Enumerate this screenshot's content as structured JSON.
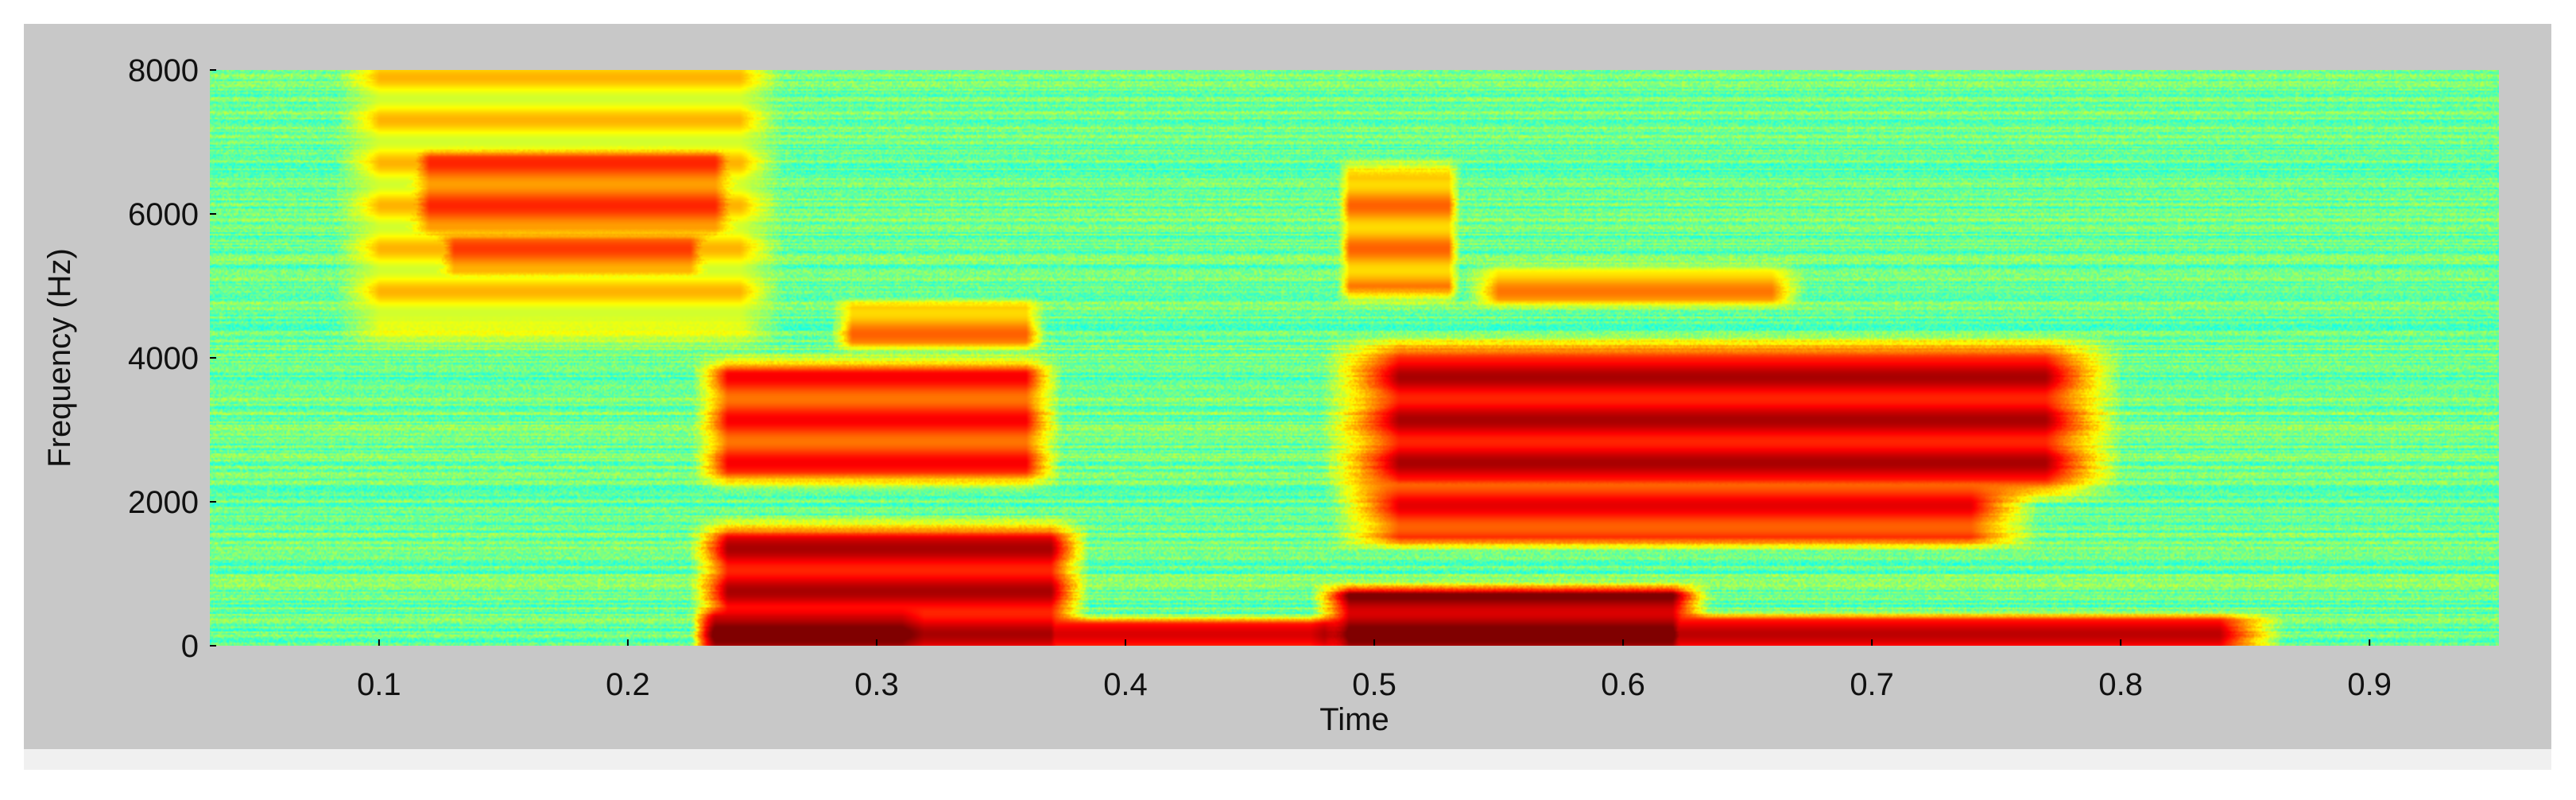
{
  "chart_data": {
    "type": "heatmap",
    "xlabel": "Time",
    "ylabel": "Frequency (Hz)",
    "xlim": [
      0.032,
      0.952
    ],
    "ylim": [
      0,
      8000
    ],
    "x_ticks": [
      0.1,
      0.2,
      0.3,
      0.4,
      0.5,
      0.6,
      0.7,
      0.8,
      0.9
    ],
    "x_tick_labels": [
      "0.1",
      "0.2",
      "0.3",
      "0.4",
      "0.5",
      "0.6",
      "0.7",
      "0.8",
      "0.9"
    ],
    "y_ticks": [
      0,
      2000,
      4000,
      6000,
      8000
    ],
    "y_tick_labels": [
      "0",
      "2000",
      "4000",
      "6000",
      "8000"
    ],
    "colormap": "jet",
    "background_level": 0.48,
    "energy_regions": [
      {
        "t_start": 0.12,
        "t_end": 0.235,
        "f_low": 5800,
        "f_high": 6800,
        "intensity": 0.78
      },
      {
        "t_start": 0.13,
        "t_end": 0.225,
        "f_low": 5200,
        "f_high": 5650,
        "intensity": 0.76
      },
      {
        "t_start": 0.1,
        "t_end": 0.245,
        "f_low": 4600,
        "f_high": 8000,
        "intensity": 0.64
      },
      {
        "t_start": 0.24,
        "t_end": 0.37,
        "f_low": 0,
        "f_high": 1500,
        "intensity": 0.9
      },
      {
        "t_start": 0.235,
        "t_end": 0.31,
        "f_low": 0,
        "f_high": 400,
        "intensity": 0.97
      },
      {
        "t_start": 0.24,
        "t_end": 0.36,
        "f_low": 2400,
        "f_high": 3800,
        "intensity": 0.82
      },
      {
        "t_start": 0.29,
        "t_end": 0.36,
        "f_low": 4200,
        "f_high": 4700,
        "intensity": 0.72
      },
      {
        "t_start": 0.37,
        "t_end": 0.48,
        "f_low": 0,
        "f_high": 300,
        "intensity": 0.85
      },
      {
        "t_start": 0.49,
        "t_end": 0.53,
        "f_low": 5000,
        "f_high": 6500,
        "intensity": 0.72
      },
      {
        "t_start": 0.49,
        "t_end": 0.62,
        "f_low": 0,
        "f_high": 700,
        "intensity": 0.97
      },
      {
        "t_start": 0.62,
        "t_end": 0.84,
        "f_low": 0,
        "f_high": 350,
        "intensity": 0.88
      },
      {
        "t_start": 0.51,
        "t_end": 0.77,
        "f_low": 2300,
        "f_high": 4000,
        "intensity": 0.9
      },
      {
        "t_start": 0.51,
        "t_end": 0.74,
        "f_low": 1500,
        "f_high": 2200,
        "intensity": 0.84
      },
      {
        "t_start": 0.55,
        "t_end": 0.66,
        "f_low": 4800,
        "f_high": 5200,
        "intensity": 0.7
      }
    ],
    "colors": {
      "figure_background": "#c8c8c8",
      "below_strip": "#f0f0f0",
      "text": "#111111"
    }
  }
}
